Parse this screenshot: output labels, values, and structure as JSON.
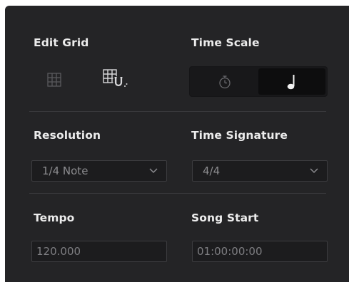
{
  "edit_grid": {
    "label": "Edit Grid",
    "icons": [
      "grid-icon",
      "snap-grid-icon"
    ]
  },
  "time_scale": {
    "label": "Time Scale",
    "options": [
      "stopwatch-icon",
      "quarter-note-icon"
    ],
    "selected": "quarter-note-icon"
  },
  "resolution": {
    "label": "Resolution",
    "value": "1/4 Note"
  },
  "time_signature": {
    "label": "Time Signature",
    "value": "4/4"
  },
  "tempo": {
    "label": "Tempo",
    "value": "120.000"
  },
  "song_start": {
    "label": "Song Start",
    "value": "01:00:00:00"
  }
}
